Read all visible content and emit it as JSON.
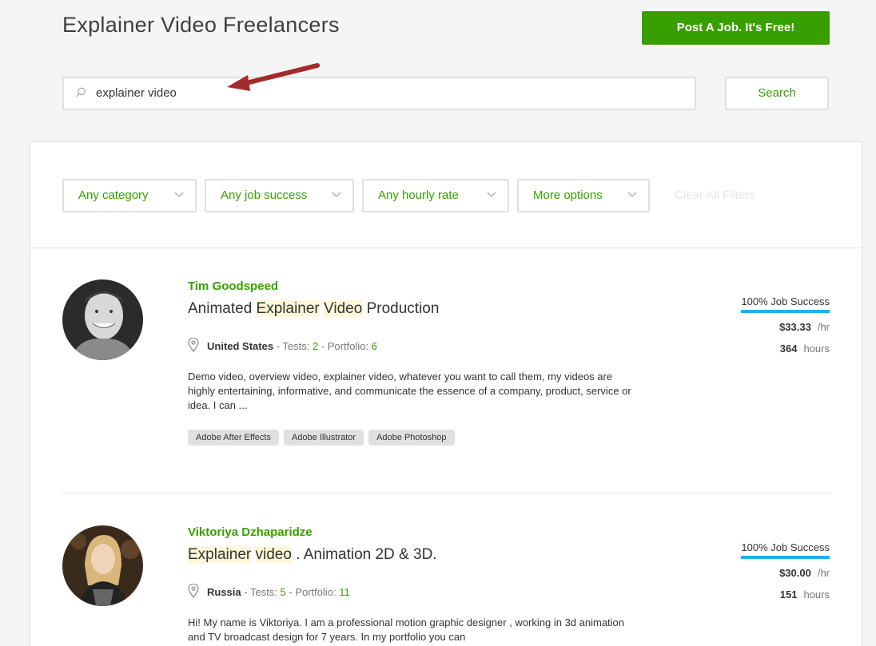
{
  "header": {
    "title": "Explainer Video Freelancers",
    "post_job_label": "Post A Job. It's Free!"
  },
  "search": {
    "value": "explainer video",
    "button_label": "Search"
  },
  "filters": [
    {
      "label": "Any category"
    },
    {
      "label": "Any job success"
    },
    {
      "label": "Any hourly rate"
    },
    {
      "label": "More options"
    }
  ],
  "clear_filters_label": "Clear All Filters",
  "freelancers": [
    {
      "name": "Tim Goodspeed",
      "headline_parts": [
        "Animated ",
        "Explainer",
        " ",
        "Video",
        " Production"
      ],
      "country": "United States",
      "tests_label": " - Tests: ",
      "tests": "2",
      "portfolio_label": " - Portfolio: ",
      "portfolio": "6",
      "description": "Demo video, overview video, explainer video, whatever you want to call them, my videos are highly entertaining, informative, and communicate the essence of a company, product, service or idea. I can ...",
      "skills": [
        "Adobe After Effects",
        "Adobe Illustrator",
        "Adobe Photoshop"
      ],
      "job_success": "100% Job Success",
      "rate": "$33.33",
      "rate_unit": "/hr",
      "hours": "364",
      "hours_unit": "hours"
    },
    {
      "name": "Viktoriya Dzhaparidze",
      "headline_parts": [
        "",
        "Explainer",
        " ",
        "video",
        " . Animation 2D & 3D."
      ],
      "country": "Russia",
      "tests_label": " - Tests: ",
      "tests": "5",
      "portfolio_label": " - Portfolio: ",
      "portfolio": "11",
      "description": "Hi! My name is Viktoriya. I am a professional motion graphic designer , working in 3d animation and TV broadcast design for 7 years. In my portfolio you can",
      "job_success": "100% Job Success",
      "rate": "$30.00",
      "rate_unit": "/hr",
      "hours": "151",
      "hours_unit": "hours"
    }
  ],
  "colors": {
    "accent_green": "#37a000",
    "job_success_bar": "#1fb2e8",
    "highlight": "#fcf8d9",
    "annotation_arrow": "#a52a2a"
  }
}
